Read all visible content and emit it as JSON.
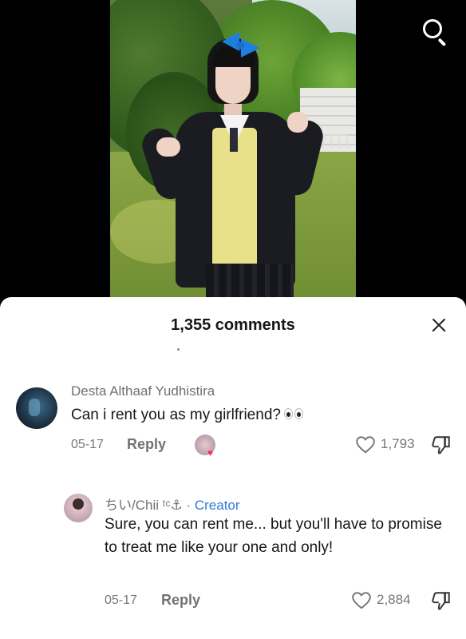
{
  "header": {
    "search_icon": "search-icon"
  },
  "sheet": {
    "title": "1,355 comments",
    "close_icon": "close-icon"
  },
  "comments": [
    {
      "username": "Desta Althaaf Yudhistira",
      "text": "Can i rent you as my girlfriend?",
      "date": "05-17",
      "reply_label": "Reply",
      "likes": "1,793",
      "liked_by_creator": true
    },
    {
      "username": "ちい/Chii ᵗᶜ⚓",
      "creator_label": " · Creator",
      "text": "Sure, you can rent me... but you'll have to promise to treat me like your one and only!",
      "date": "05-17",
      "reply_label": "Reply",
      "likes": "2,884"
    }
  ],
  "colors": {
    "accent": "#fe2c55",
    "creator": "#2f78d8",
    "muted": "#777777"
  }
}
